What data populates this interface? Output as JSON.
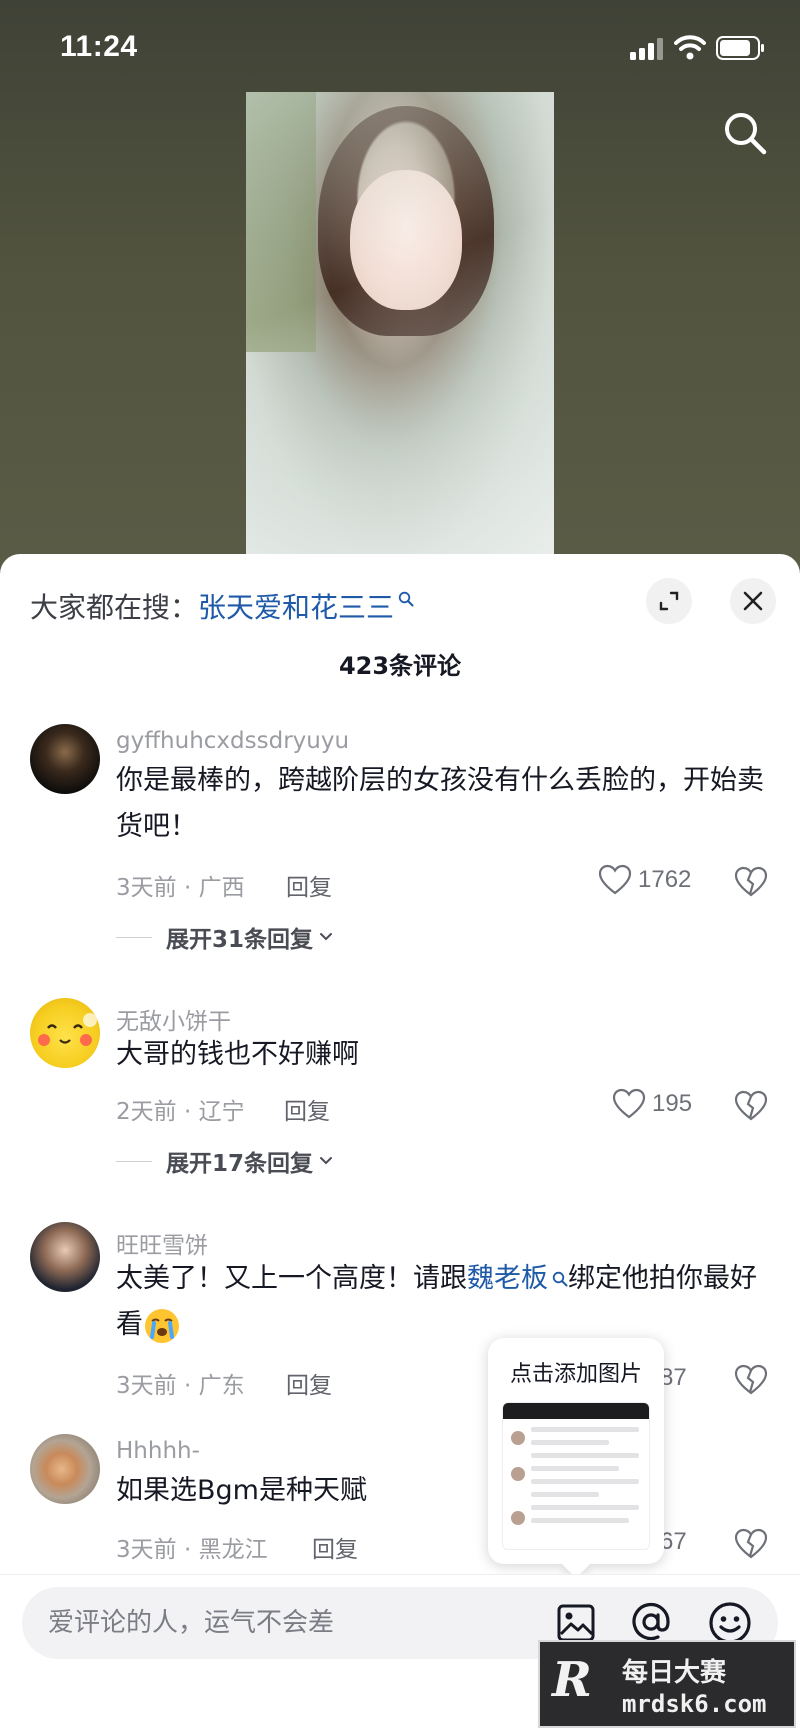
{
  "status_bar": {
    "time": "11:24"
  },
  "trending": {
    "prefix": "大家都在搜：",
    "term": "张天爱和花三三"
  },
  "header": {
    "comment_count": "423条评论"
  },
  "comments": [
    {
      "username": "gyffhuhcxdssdryuyu",
      "text": "你是最棒的，跨越阶层的女孩没有什么丢脸的，开始卖货吧！",
      "meta": "3天前 · 广西",
      "reply_label": "回复",
      "likes": "1762",
      "expand": "展开31条回复"
    },
    {
      "username": "无敌小饼干",
      "text": "大哥的钱也不好赚啊",
      "meta": "2天前 · 辽宁",
      "reply_label": "回复",
      "likes": "195",
      "expand": "展开17条回复"
    },
    {
      "username": "旺旺雪饼",
      "text_before": "太美了！又上一个高度！请跟",
      "text_link": "魏老板",
      "text_after": "绑定他拍你最好看",
      "meta": "3天前 · 广东",
      "reply_label": "回复",
      "likes": "87"
    },
    {
      "username": "Hhhhh-",
      "text": "如果选Bgm是种天赋",
      "meta": "3天前 · 黑龙江",
      "reply_label": "回复",
      "likes": "67"
    }
  ],
  "image_popup": {
    "label": "点击添加图片"
  },
  "input": {
    "placeholder": "爱评论的人，运气不会差"
  },
  "watermark": {
    "logo": "R",
    "title": "每日大赛",
    "site": "mrdsk6.com"
  },
  "colors": {
    "link": "#1f5aa8",
    "muted": "#9a9ca2",
    "text": "#161823",
    "backdrop": "#4b4d3d"
  }
}
